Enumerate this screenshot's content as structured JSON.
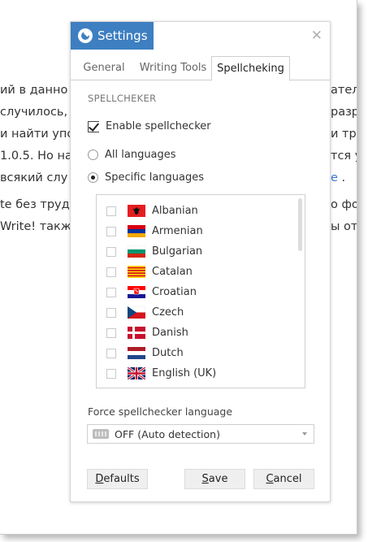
{
  "background": {
    "lines": [
      "ий в данно",
      "случилось, и",
      "и найти упо",
      "1.0.5. Но на",
      "всякий слу",
      "te без труда",
      "Write! такж"
    ],
    "right_fragments": [
      "ател",
      "разр",
      "и тру",
      "тся у",
      "о фо",
      "ы от"
    ],
    "link_fragment": "e",
    "link_tail": " ."
  },
  "dialog": {
    "title": "Settings",
    "title_icon": "app-logo-icon",
    "close_icon": "close-icon",
    "close_glyph": "✕",
    "tabs": [
      {
        "label": "General",
        "active": false
      },
      {
        "label": "Writing Tools",
        "active": false
      },
      {
        "label": "Spellcheking",
        "active": true
      }
    ],
    "section_title": "SPELLCHEKER",
    "enable_spellchecker": {
      "label": "Enable spellchecker",
      "checked": true
    },
    "mode": {
      "all_languages": {
        "label": "All languages",
        "selected": false
      },
      "specific_languages": {
        "label": "Specific languages",
        "selected": true
      }
    },
    "languages": [
      {
        "name": "Albanian",
        "checked": false,
        "flag": "albania-flag-icon"
      },
      {
        "name": "Armenian",
        "checked": false,
        "flag": "armenia-flag-icon"
      },
      {
        "name": "Bulgarian",
        "checked": false,
        "flag": "bulgaria-flag-icon"
      },
      {
        "name": "Catalan",
        "checked": false,
        "flag": "catalonia-flag-icon"
      },
      {
        "name": "Croatian",
        "checked": false,
        "flag": "croatia-flag-icon"
      },
      {
        "name": "Czech",
        "checked": false,
        "flag": "czech-flag-icon"
      },
      {
        "name": "Danish",
        "checked": false,
        "flag": "denmark-flag-icon"
      },
      {
        "name": "Dutch",
        "checked": false,
        "flag": "netherlands-flag-icon"
      },
      {
        "name": "English (UK)",
        "checked": false,
        "flag": "uk-flag-icon"
      }
    ],
    "force_language": {
      "label": "Force spellchecker language",
      "value": "OFF (Auto detection)",
      "icon": "keyboard-icon"
    },
    "buttons": {
      "defaults": {
        "mnemonic": "D",
        "rest": "efaults"
      },
      "save": {
        "mnemonic": "S",
        "rest": "ave"
      },
      "cancel": {
        "mnemonic": "C",
        "rest": "ancel"
      }
    }
  }
}
